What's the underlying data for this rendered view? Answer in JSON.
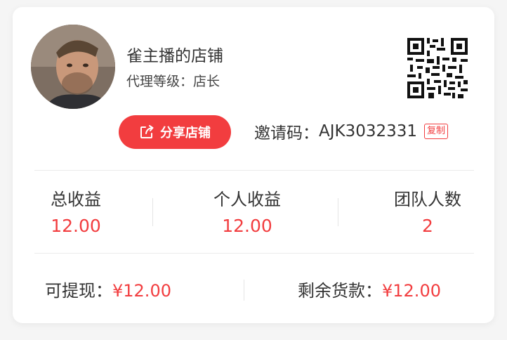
{
  "profile": {
    "store_name": "雀主播的店铺",
    "agent_level_label": "代理等级：",
    "agent_level_value": "店长"
  },
  "share": {
    "label": "分享店铺"
  },
  "invite": {
    "label": "邀请码：",
    "code": "AJK3032331",
    "copy_label": "复制"
  },
  "stats": [
    {
      "label": "总收益",
      "value": "12.00"
    },
    {
      "label": "个人收益",
      "value": "12.00"
    },
    {
      "label": "团队人数",
      "value": "2"
    }
  ],
  "balances": {
    "withdrawable_label": "可提现：",
    "withdrawable_value": "¥12.00",
    "remaining_goods_label": "剩余货款：",
    "remaining_goods_value": "¥12.00"
  },
  "colors": {
    "accent": "#f23d3f",
    "text": "#333333",
    "divider": "#ebebeb"
  },
  "icons": {
    "share": "share-icon",
    "qr": "qr-code-icon",
    "avatar": "avatar"
  }
}
